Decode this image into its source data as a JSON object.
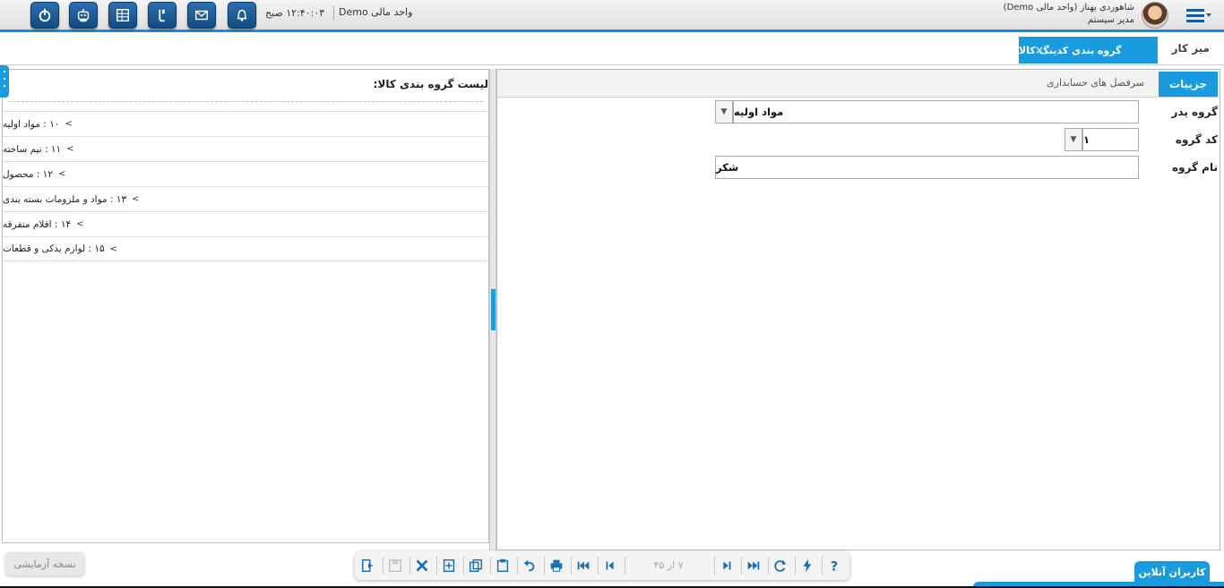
{
  "header": {
    "datetime": "۱۲:۴۰:۰۳ صبح",
    "unit": "واحد مالی Demo",
    "user_line1": "شاهوردی بهناز (واحد مالی Demo)",
    "user_line2": "مدیر سیستم",
    "icons": [
      "power-icon",
      "printer-robot-icon",
      "spreadsheet-icon",
      "phone-icon",
      "mail-icon",
      "bell-icon"
    ]
  },
  "tabs": {
    "desk": "میز کار",
    "active": "گروه بندی کدینگ کالا",
    "close": "×"
  },
  "list_panel": {
    "title": "لیست گروه بندی کالا:",
    "items": [
      {
        "label": "۱۰ : مواد اولیه"
      },
      {
        "label": "۱۱ : نیم ساخته"
      },
      {
        "label": "۱۲ : محصول"
      },
      {
        "label": "۱۳ : مواد و ملزومات بسته بندی"
      },
      {
        "label": "۱۴ : اقلام متفرقه"
      },
      {
        "label": "۱۵ : لوازم یدکی و قطعات"
      }
    ]
  },
  "details": {
    "tab_details": "جزییات",
    "tab_accounts": "سرفصل های حسابداری",
    "parent_label": "گروه پدر",
    "parent_value": "مواد اولیه",
    "code_label": "کد گروه",
    "code_value": "۱",
    "name_label": "نام گروه",
    "name_value": "شکر"
  },
  "footer": {
    "trial": "نسخه آزمایشی",
    "pager": "۷ از ۴۵",
    "online_users": "کاربران آنلاین"
  },
  "colors": {
    "accent": "#1a9be0",
    "header_button": "#1a5c9a"
  }
}
